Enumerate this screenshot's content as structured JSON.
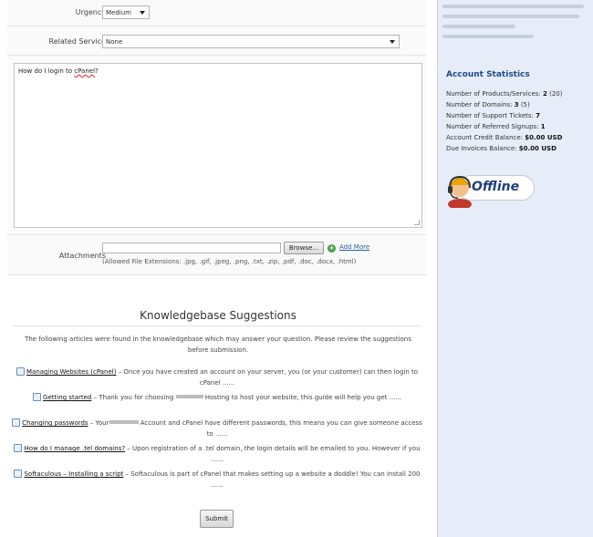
{
  "form": {
    "urgency_label": "Urgency",
    "urgency_value": "Medium",
    "related_service_label": "Related Service",
    "related_service_value": "None",
    "message_text_plain": "How do I login to ",
    "message_text_misspelled": "cPanel",
    "message_text_end": "?",
    "attachments_label": "Attachments",
    "browse_label": "Browse...",
    "add_more_label": "Add More",
    "allowed_extensions": "(Allowed File Extensions: .jpg, .gif, .jpeg, .png, .txt, .zip, .pdf, .doc, .docx, .html)"
  },
  "knowledgebase": {
    "title": "Knowledgebase Suggestions",
    "intro": "The following articles were found in the knowledgebase which may answer your question. Please review the suggestions before submission.",
    "suggestions": [
      {
        "title": "Managing Websites (cPanel)",
        "pre": " – Once you have created an account on your server, you (or your customer) can then login to cPanel ......",
        "post": ""
      },
      {
        "title": "Getting started",
        "pre": " – Thank you for choosing ",
        "post": " Hosting to host your website, this guide will help you get ......"
      },
      {
        "title": "Changing passwords",
        "pre": " – Your",
        "post": " Account and cPanel have different passwords, this means you can give someone access to ......"
      },
      {
        "title": "How do I manage .tel domains?",
        "pre": " – Upon registration of a .tel domain, the login details will be emailed to you. However if you ......",
        "post": ""
      },
      {
        "title": "Softaculous – Installing a script",
        "pre": " – Softaculous is part of cPanel that makes setting up a website a doddle! You can install 200 ......",
        "post": ""
      }
    ],
    "submit_label": "Submit"
  },
  "sidebar": {
    "stats_title": "Account Statistics",
    "stats": [
      {
        "label": "Number of Products/Services: ",
        "value": "2",
        "extra": " (20)"
      },
      {
        "label": "Number of Domains: ",
        "value": "3",
        "extra": " (5)"
      },
      {
        "label": "Number of Support Tickets: ",
        "value": "7",
        "extra": ""
      },
      {
        "label": "Number of Referred Signups: ",
        "value": "1",
        "extra": ""
      },
      {
        "label": "Account Credit Balance: ",
        "value": "$0.00 USD",
        "extra": ""
      },
      {
        "label": "Due Invoices Balance: ",
        "value": "$0.00 USD",
        "extra": ""
      }
    ],
    "live_chat_status": "Offline",
    "live_chat_icon": "headset-agent-icon"
  },
  "colors": {
    "sidebar_bg": "#e6edf8",
    "stats_title": "#1f4b8a",
    "link": "#2a5ea8",
    "add_icon": "#4aa04a"
  }
}
